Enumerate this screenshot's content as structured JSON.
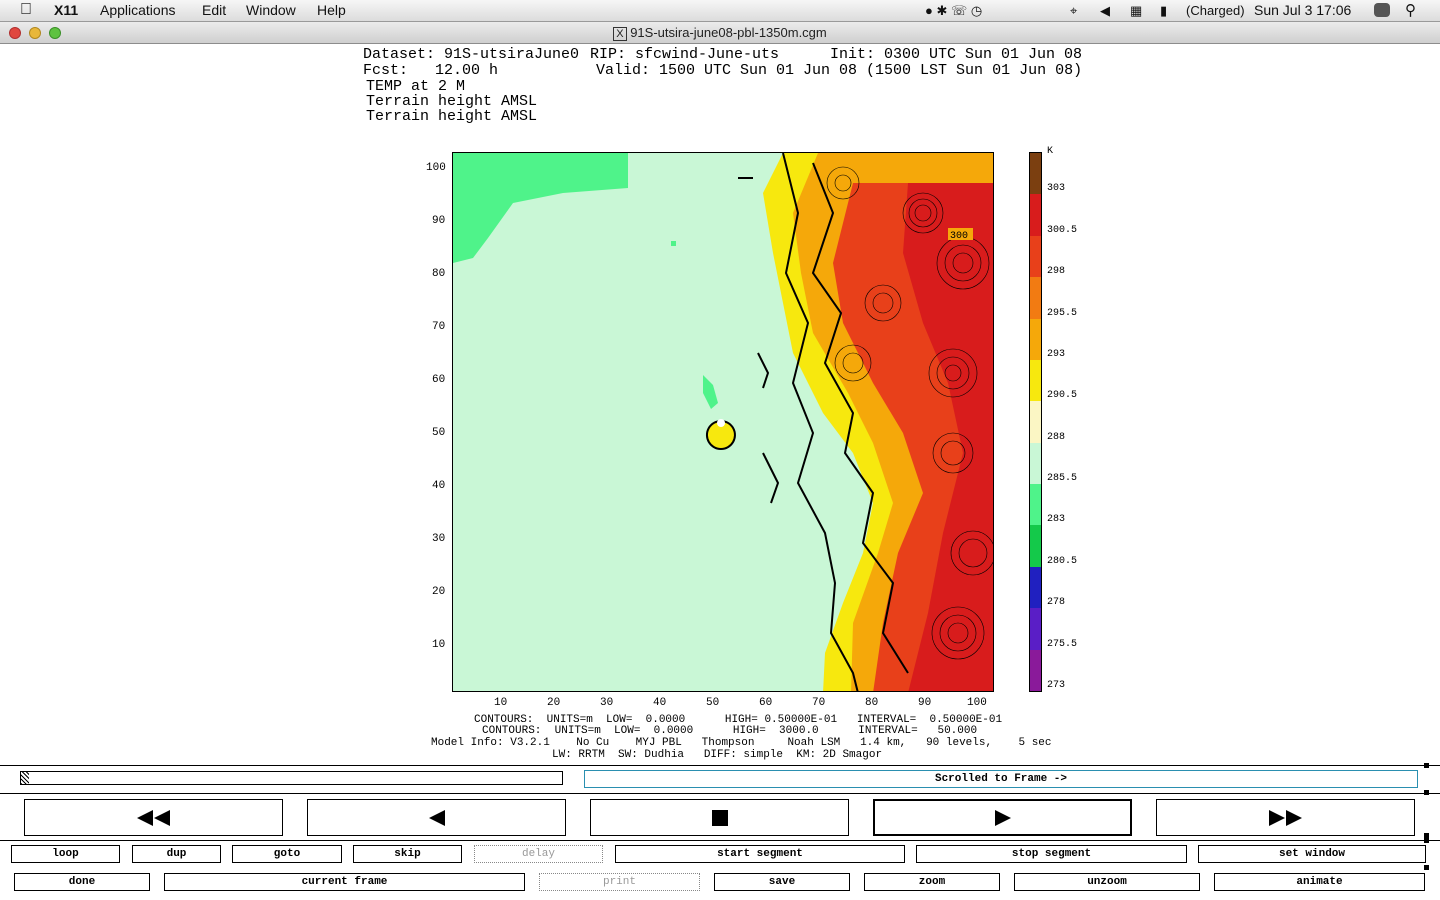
{
  "menubar": {
    "app": "X11",
    "items": [
      "Applications",
      "Edit",
      "Window",
      "Help"
    ],
    "battery": "(Charged)",
    "clock": "Sun Jul 3  17:06"
  },
  "window": {
    "title": "91S-utsira-june08-pbl-1350m.cgm"
  },
  "plot_header": {
    "dataset": "Dataset: 91S-utsiraJune0",
    "rip": "RIP: sfcwind-June-uts",
    "init": "Init: 0300 UTC Sun 01 Jun 08",
    "fcst": "Fcst:   12.00 h",
    "valid": "Valid: 1500 UTC Sun 01 Jun 08 (1500 LST Sun 01 Jun 08)",
    "field1": "TEMP at 2 M",
    "field2": "Terrain height AMSL",
    "field3": "Terrain height AMSL"
  },
  "axes": {
    "x_ticks": [
      "10",
      "20",
      "30",
      "40",
      "50",
      "60",
      "70",
      "80",
      "90",
      "100"
    ],
    "y_ticks": [
      "100",
      "90",
      "80",
      "70",
      "60",
      "50",
      "40",
      "30",
      "20",
      "10"
    ]
  },
  "contour_label": "300",
  "colorbar": {
    "unit": "K",
    "labels": [
      "303",
      "300.5",
      "298",
      "295.5",
      "293",
      "290.5",
      "288",
      "285.5",
      "283",
      "280.5",
      "278",
      "275.5",
      "273"
    ],
    "colors": [
      "#7b3f10",
      "#d81c1c",
      "#e8401a",
      "#f27b12",
      "#f5a80a",
      "#f7e80e",
      "#fbf6c4",
      "#c9f7d6",
      "#4ff38a",
      "#14c94a",
      "#2020c0",
      "#5a1ec6",
      "#8a1a9a"
    ]
  },
  "footer": {
    "line1": "CONTOURS:  UNITS=m  LOW=  0.0000      HIGH= 0.50000E-01   INTERVAL=  0.50000E-01",
    "line2": "CONTOURS:  UNITS=m  LOW=  0.0000      HIGH=  3000.0      INTERVAL=   50.000",
    "line3": "Model Info: V3.2.1    No Cu    MYJ PBL   Thompson     Noah LSM   1.4 km,   90 levels,    5 sec",
    "line4": "LW: RRTM  SW: Dudhia   DIFF: simple  KM: 2D Smagor"
  },
  "frame_status": "Scrolled to Frame ->",
  "buttons_row1": [
    "loop",
    "dup",
    "goto",
    "skip",
    "delay",
    "start segment",
    "stop segment",
    "set window"
  ],
  "buttons_row2": [
    "done",
    "current frame",
    "print",
    "save",
    "zoom",
    "unzoom",
    "animate"
  ]
}
